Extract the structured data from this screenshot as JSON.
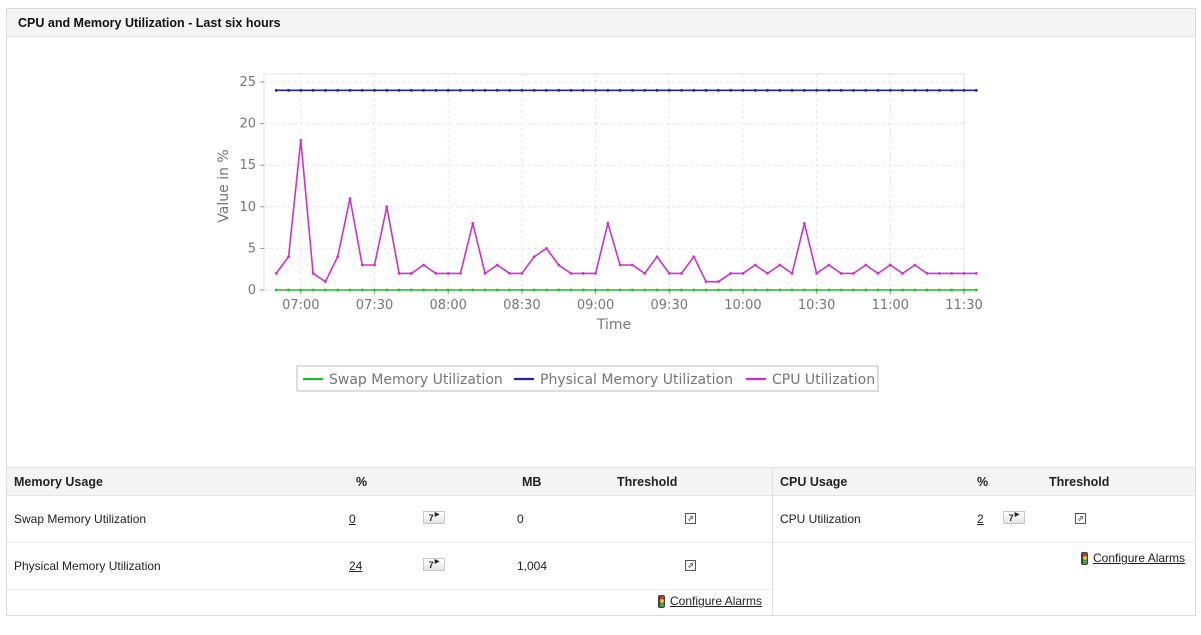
{
  "panel": {
    "title": "CPU and Memory Utilization - Last six hours"
  },
  "chart_data": {
    "type": "line",
    "title": "",
    "xlabel": "Time",
    "ylabel": "Value in %",
    "ylim": [
      0,
      25
    ],
    "yticks": [
      0,
      5,
      10,
      15,
      20,
      25
    ],
    "xticks": [
      "07:00",
      "07:30",
      "08:00",
      "08:30",
      "09:00",
      "09:30",
      "10:00",
      "10:30",
      "11:00",
      "11:30"
    ],
    "x_start": "06:45",
    "x_end": "11:30",
    "x_step_minutes": 5,
    "grid": true,
    "legend_position": "bottom",
    "series": [
      {
        "name": "Swap Memory Utilization",
        "color": "#22bb22",
        "values": [
          0,
          0,
          0,
          0,
          0,
          0,
          0,
          0,
          0,
          0,
          0,
          0,
          0,
          0,
          0,
          0,
          0,
          0,
          0,
          0,
          0,
          0,
          0,
          0,
          0,
          0,
          0,
          0,
          0,
          0,
          0,
          0,
          0,
          0,
          0,
          0,
          0,
          0,
          0,
          0,
          0,
          0,
          0,
          0,
          0,
          0,
          0,
          0,
          0,
          0,
          0,
          0,
          0,
          0,
          0,
          0,
          0,
          0
        ]
      },
      {
        "name": "Physical Memory Utilization",
        "color": "#2222aa",
        "values": [
          24,
          24,
          24,
          24,
          24,
          24,
          24,
          24,
          24,
          24,
          24,
          24,
          24,
          24,
          24,
          24,
          24,
          24,
          24,
          24,
          24,
          24,
          24,
          24,
          24,
          24,
          24,
          24,
          24,
          24,
          24,
          24,
          24,
          24,
          24,
          24,
          24,
          24,
          24,
          24,
          24,
          24,
          24,
          24,
          24,
          24,
          24,
          24,
          24,
          24,
          24,
          24,
          24,
          24,
          24,
          24,
          24,
          24
        ]
      },
      {
        "name": "CPU Utilization",
        "color": "#cc33cc",
        "values": [
          2,
          4,
          18,
          2,
          1,
          4,
          11,
          3,
          3,
          10,
          2,
          2,
          3,
          2,
          2,
          2,
          8,
          2,
          3,
          2,
          2,
          4,
          5,
          3,
          2,
          2,
          2,
          8,
          3,
          3,
          2,
          4,
          2,
          2,
          4,
          1,
          1,
          2,
          2,
          3,
          2,
          3,
          2,
          8,
          2,
          3,
          2,
          2,
          3,
          2,
          3,
          2,
          3,
          2,
          2,
          2,
          2,
          2
        ]
      }
    ]
  },
  "memory": {
    "headers": {
      "name": "Memory Usage",
      "percent": "%",
      "mb": "MB",
      "threshold": "Threshold"
    },
    "rows": [
      {
        "name": "Swap Memory Utilization",
        "percent": "0",
        "mb": "0",
        "btn": "7"
      },
      {
        "name": "Physical Memory Utilization",
        "percent": "24",
        "mb": "1,004",
        "btn": "7"
      }
    ],
    "configure": "Configure Alarms"
  },
  "cpu": {
    "headers": {
      "name": "CPU Usage",
      "percent": "%",
      "threshold": "Threshold"
    },
    "rows": [
      {
        "name": "CPU Utilization",
        "percent": "2",
        "btn": "7"
      }
    ],
    "configure": "Configure Alarms"
  },
  "icons": {
    "threshold": "external-link-icon",
    "alarm": "traffic-light-icon",
    "period": "calendar-7-icon"
  }
}
